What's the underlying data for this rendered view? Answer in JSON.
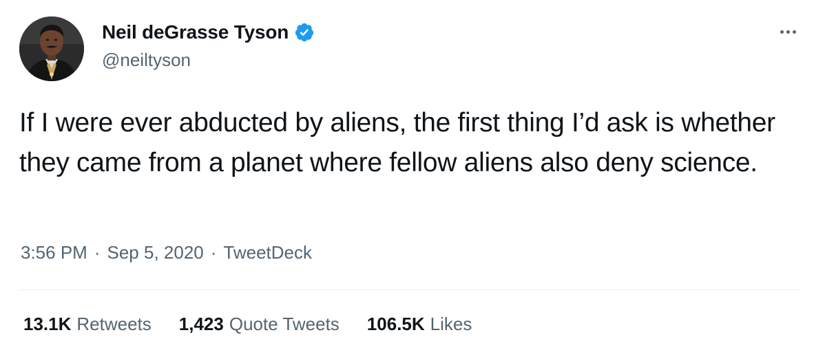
{
  "author": {
    "display_name": "Neil deGrasse Tyson",
    "handle": "@neiltyson",
    "verified": true,
    "verified_color": "#1d9bf0"
  },
  "tweet": {
    "text": "If I were ever abducted by aliens, the first thing I’d ask is whether they came from a planet where fellow aliens also deny science."
  },
  "meta": {
    "time": "3:56 PM",
    "separator": "·",
    "date": "Sep 5, 2020",
    "source": "TweetDeck"
  },
  "stats": {
    "retweets": {
      "count": "13.1K",
      "label": "Retweets"
    },
    "quote_tweets": {
      "count": "1,423",
      "label": "Quote Tweets"
    },
    "likes": {
      "count": "106.5K",
      "label": "Likes"
    }
  },
  "icons": {
    "more": "more-horizontal-icon",
    "verified": "verified-badge-icon"
  },
  "colors": {
    "text_primary": "#0f1419",
    "text_secondary": "#536471",
    "divider": "#e6ecf0"
  }
}
